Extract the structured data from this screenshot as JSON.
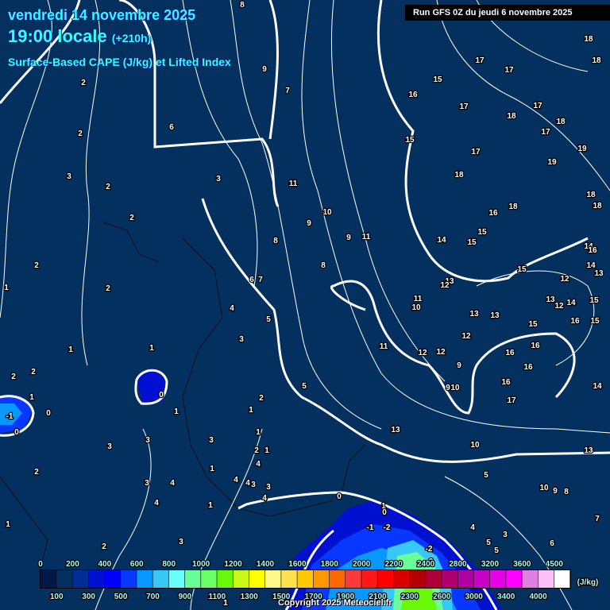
{
  "header": {
    "date": "vendredi 14 novembre 2025",
    "time": "19:00 locale",
    "lead": "(+210h)",
    "parameter": "Surface-Based CAPE (J/kg) et Lifted Index",
    "run": "Run GFS 0Z du jeudi 6 novembre 2025"
  },
  "colorbar": {
    "unit": "(J/kg)",
    "top_labels": [
      "0",
      "200",
      "400",
      "600",
      "800",
      "1000",
      "1200",
      "1400",
      "1600",
      "1800",
      "2000",
      "2200",
      "2400",
      "2800",
      "3200",
      "3600",
      "4500"
    ],
    "bottom_labels": [
      "100",
      "300",
      "500",
      "700",
      "900",
      "1100",
      "1300",
      "1500",
      "1700",
      "1900",
      "2100",
      "2300",
      "2600",
      "3000",
      "3400",
      "4000"
    ],
    "colors": [
      "#001848",
      "#03305e",
      "#002e98",
      "#0010d0",
      "#0000ff",
      "#0838ff",
      "#0898ff",
      "#38c8f8",
      "#68ffff",
      "#68ff98",
      "#68ff68",
      "#68f808",
      "#c8f818",
      "#ffff00",
      "#fff888",
      "#ffe050",
      "#ffc800",
      "#ff9800",
      "#ff6800",
      "#ff3838",
      "#ff1818",
      "#ff0000",
      "#d80000",
      "#b00000",
      "#b00038",
      "#b00070",
      "#b000a0",
      "#c800c8",
      "#e800e8",
      "#ff00ff",
      "#e080e0",
      "#ffc0f8",
      "#ffffff"
    ]
  },
  "lifted_index_labels": [
    "8",
    "7",
    "9",
    "2",
    "6",
    "2",
    "3",
    "2",
    "3",
    "2",
    "2",
    "1",
    "2",
    "8",
    "9",
    "10",
    "11",
    "9",
    "11",
    "8",
    "6",
    "7",
    "4",
    "5",
    "3",
    "1",
    "1",
    "2",
    "2",
    "0",
    "2",
    "5",
    "1",
    "1",
    "0",
    "-1",
    "0",
    "1",
    "1",
    "3",
    "3",
    "3",
    "2",
    "1",
    "4",
    "1",
    "2",
    "3",
    "4",
    "4",
    "4",
    "3",
    "3",
    "4",
    "4",
    "1",
    "0",
    "1",
    "0",
    "-1",
    "-2",
    "1",
    "3",
    "2",
    "-2",
    "-2",
    "4",
    "5",
    "5",
    "3",
    "15",
    "16",
    "17",
    "17",
    "18",
    "18",
    "17",
    "18",
    "17",
    "18",
    "17",
    "19",
    "19",
    "17",
    "18",
    "15",
    "18",
    "18",
    "18",
    "16",
    "15",
    "15",
    "14",
    "14",
    "16",
    "14",
    "13",
    "15",
    "12",
    "13",
    "12",
    "11",
    "10",
    "13",
    "12",
    "14",
    "15",
    "13",
    "13",
    "15",
    "16",
    "15",
    "11",
    "12",
    "12",
    "12",
    "16",
    "16",
    "9",
    "16",
    "9",
    "10",
    "16",
    "17",
    "14",
    "13",
    "10",
    "13",
    "5",
    "10",
    "9",
    "8",
    "7",
    "6",
    "1"
  ],
  "copyright": "Copyright 2025 Meteociel.fr"
}
